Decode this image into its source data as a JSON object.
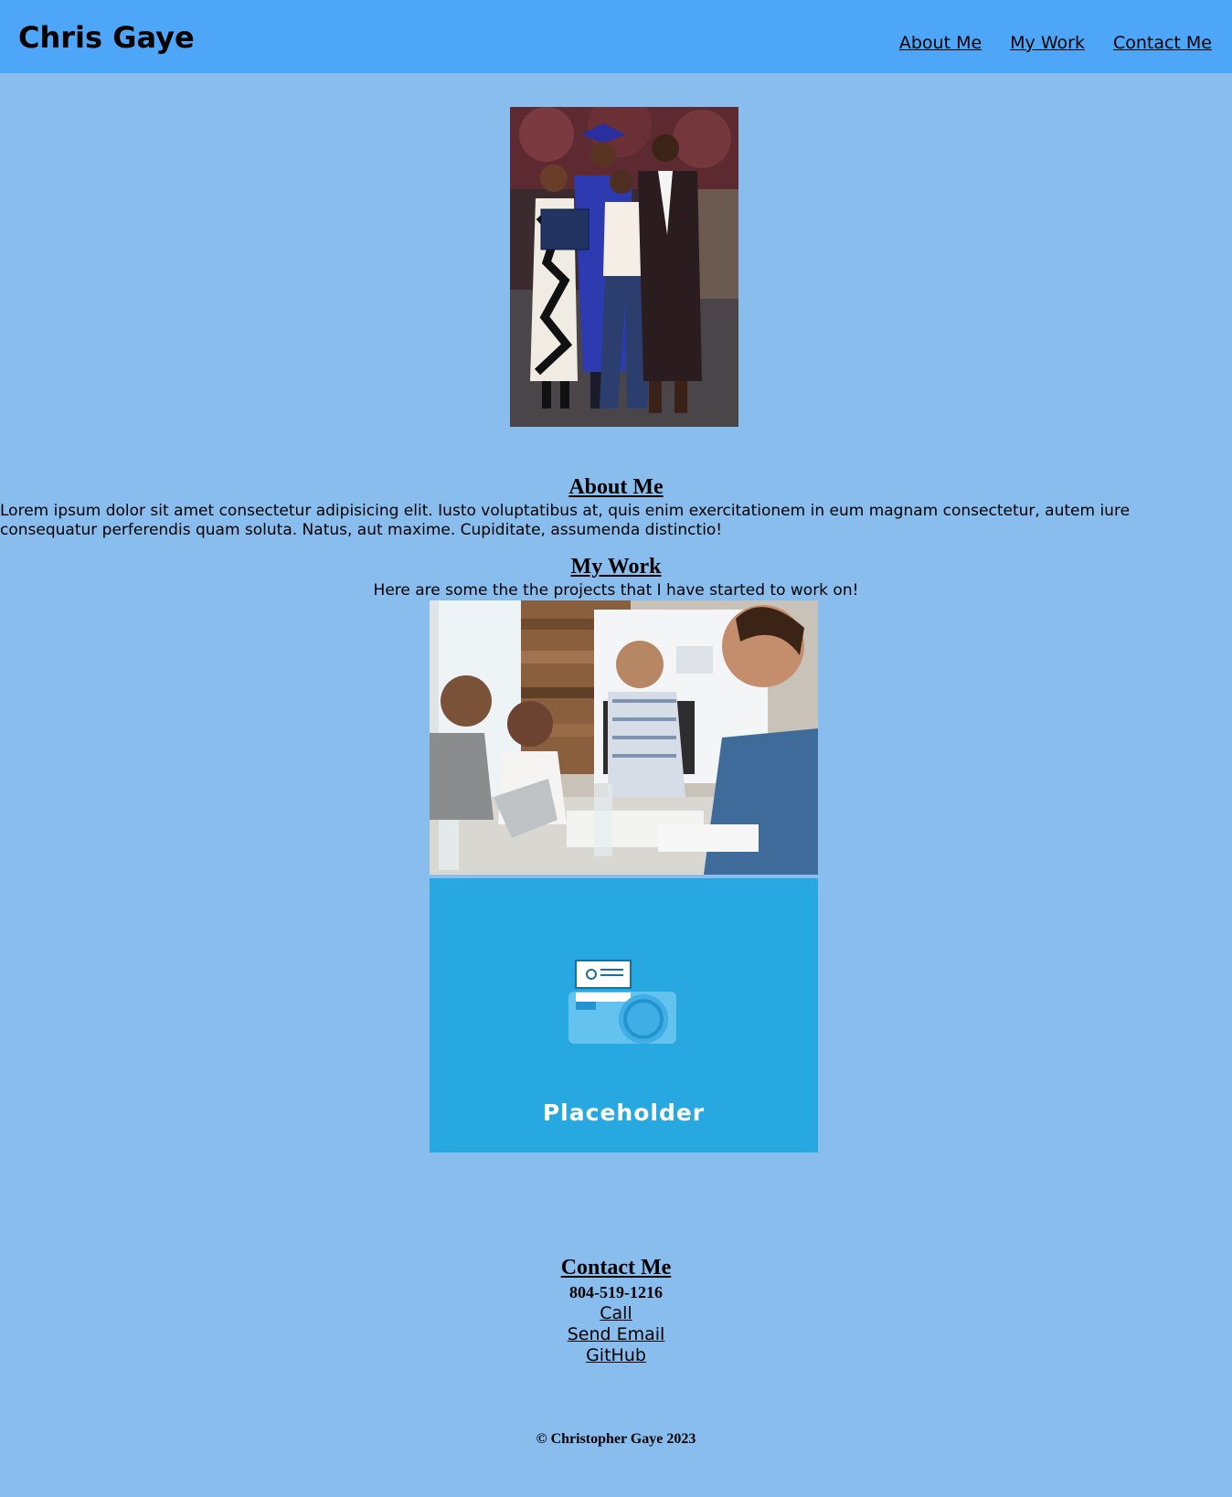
{
  "header": {
    "site_title": "Chris Gaye",
    "nav": [
      "About Me",
      "My Work",
      "Contact Me"
    ]
  },
  "colors": {
    "header_bg": "#4da6f8",
    "page_bg": "#88bded",
    "placeholder_bg": "#27a8e0"
  },
  "about": {
    "title": "About Me",
    "text": "Lorem ipsum dolor sit amet consectetur adipisicing elit. Iusto voluptatibus at, quis enim exercitationem in eum magnam consectetur, autem iure consequatur perferendis quam soluta. Natus, aut maxime. Cupiditate, assumenda distinctio!"
  },
  "work": {
    "title": "My Work",
    "intro": "Here are some the the projects that I have started to work on!",
    "projects": [
      {
        "image": "team-meeting-photo"
      },
      {
        "image": "placeholder-image",
        "label": "Placeholder"
      }
    ]
  },
  "contact": {
    "title": "Contact Me",
    "phone": "804-519-1216",
    "links": [
      "Call",
      "Send Email",
      "GitHub"
    ]
  },
  "footer": {
    "text": "© Christopher Gaye 2023"
  }
}
